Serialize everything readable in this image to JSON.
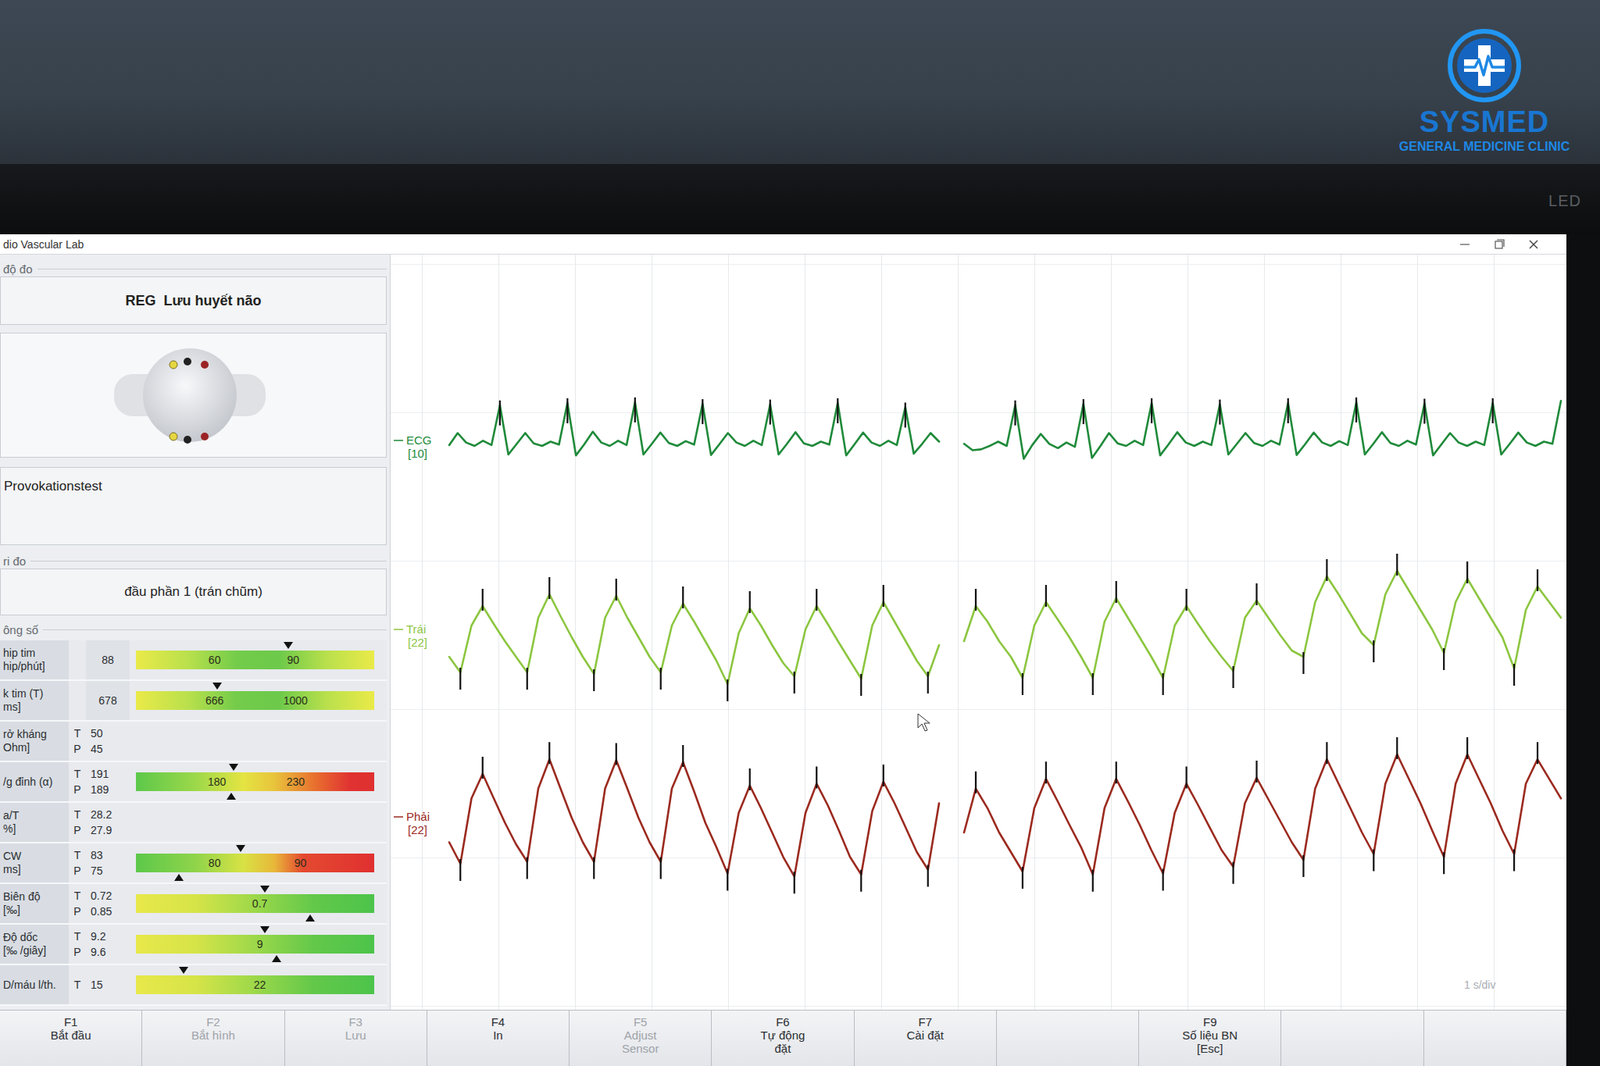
{
  "brand": {
    "name": "SYSMED",
    "tagline": "GENERAL MEDICINE CLINIC"
  },
  "monitor": {
    "badge": "LED"
  },
  "window": {
    "title": "dio Vascular Lab"
  },
  "mode": {
    "label": "độ đo",
    "value": "REG  Lưu huyết não"
  },
  "test": {
    "value": "Provokationstest"
  },
  "position": {
    "label": "ri đo",
    "value": "đầu phần 1 (trán chũm)"
  },
  "params": {
    "label": "ông số",
    "rows": [
      {
        "lines": [
          "hip tim",
          "hip/phút]"
        ],
        "values": [
          {
            "tag": "",
            "value": "88"
          }
        ],
        "bar": {
          "kind": "mid-good",
          "ticks": [
            {
              "label": "60",
              "level": 0.33
            },
            {
              "label": "90",
              "level": 0.66
            }
          ],
          "markers": [
            {
              "side": "top",
              "level": 0.64
            }
          ]
        }
      },
      {
        "lines": [
          "k tim (T)",
          "ms]"
        ],
        "values": [
          {
            "tag": "",
            "value": "678"
          }
        ],
        "bar": {
          "kind": "mid-good",
          "ticks": [
            {
              "label": "666",
              "level": 0.33
            },
            {
              "label": "1000",
              "level": 0.67
            }
          ],
          "markers": [
            {
              "side": "top",
              "level": 0.34
            }
          ]
        }
      },
      {
        "lines": [
          "rở kháng",
          "Ohm]"
        ],
        "values": [
          {
            "tag": "T",
            "value": "50"
          },
          {
            "tag": "P",
            "value": "45"
          }
        ],
        "bar": null
      },
      {
        "lines": [
          "/g đỉnh (α)"
        ],
        "values": [
          {
            "tag": "T",
            "value": "191"
          },
          {
            "tag": "P",
            "value": "189"
          }
        ],
        "bar": {
          "kind": "low-good",
          "ticks": [
            {
              "label": "180",
              "level": 0.34
            },
            {
              "label": "230",
              "level": 0.67
            }
          ],
          "markers": [
            {
              "side": "top",
              "level": 0.41
            },
            {
              "side": "bottom",
              "level": 0.4
            }
          ]
        }
      },
      {
        "lines": [
          "a/T",
          "%]"
        ],
        "values": [
          {
            "tag": "T",
            "value": "28.2"
          },
          {
            "tag": "P",
            "value": "27.9"
          }
        ],
        "bar": null
      },
      {
        "lines": [
          "CW",
          "ms]"
        ],
        "values": [
          {
            "tag": "T",
            "value": "83"
          },
          {
            "tag": "P",
            "value": "75"
          }
        ],
        "bar": {
          "kind": "low-good-steep",
          "ticks": [
            {
              "label": "80",
              "level": 0.33
            },
            {
              "label": "90",
              "level": 0.69
            }
          ],
          "markers": [
            {
              "side": "top",
              "level": 0.44
            },
            {
              "side": "bottom",
              "level": 0.18
            }
          ]
        }
      },
      {
        "lines": [
          "Biên độ",
          "[‰]"
        ],
        "values": [
          {
            "tag": "T",
            "value": "0.72"
          },
          {
            "tag": "P",
            "value": "0.85"
          }
        ],
        "bar": {
          "kind": "high-good",
          "ticks": [
            {
              "label": "0.7",
              "level": 0.52
            }
          ],
          "markers": [
            {
              "side": "top",
              "level": 0.54
            },
            {
              "side": "bottom",
              "level": 0.73
            }
          ]
        }
      },
      {
        "lines": [
          "Độ dốc",
          "[‰ /giây]"
        ],
        "values": [
          {
            "tag": "T",
            "value": "9.2"
          },
          {
            "tag": "P",
            "value": "9.6"
          }
        ],
        "bar": {
          "kind": "high-good",
          "ticks": [
            {
              "label": "9",
              "level": 0.52
            }
          ],
          "markers": [
            {
              "side": "top",
              "level": 0.54
            },
            {
              "side": "bottom",
              "level": 0.59
            }
          ]
        }
      },
      {
        "lines": [
          "D/máu l/th."
        ],
        "values": [
          {
            "tag": "T",
            "value": "15"
          }
        ],
        "bar": {
          "kind": "high-good",
          "ticks": [
            {
              "label": "22",
              "level": 0.52
            }
          ],
          "markers": [
            {
              "side": "top",
              "level": 0.2
            }
          ]
        }
      }
    ]
  },
  "chart": {
    "scale_note": "1 s/div",
    "traces": [
      {
        "name": "ECG",
        "scale": "[10]",
        "kind": "ecg",
        "color": "#1f8a3a",
        "segments": [
          [
            0.02,
            0.3,
            0.08,
            0,
            0.12,
            0.02,
            0.95,
            -0.2,
            0.05,
            0.3,
            0.06,
            0,
            0.1,
            0.03,
            1.0,
            -0.22,
            0.04,
            0.33,
            0.08,
            0,
            0.12,
            0.02,
            1.02,
            -0.2,
            0.05,
            0.31,
            0.07,
            0,
            0.11,
            0.03,
            0.98,
            -0.21,
            0.04,
            0.3,
            0.08,
            0,
            0.12,
            0.02,
            0.97,
            -0.2,
            0.05,
            0.32,
            0.06,
            0,
            0.1,
            0.03,
            1.0,
            -0.22,
            0.04,
            0.31,
            0.08,
            0,
            0.12,
            0.02,
            0.9,
            -0.18,
            0.05,
            0.3,
            0.1
          ],
          [
            0.05,
            -0.1,
            -0.08,
            0,
            0.1,
            0.0,
            0.95,
            -0.3,
            0.02,
            0.28,
            0.05,
            -0.05,
            0.08,
            -0.02,
            0.98,
            -0.28,
            0.0,
            0.3,
            0.06,
            0,
            0.12,
            0.02,
            1.0,
            -0.22,
            0.04,
            0.32,
            0.08,
            0,
            0.1,
            0.02,
            0.97,
            -0.2,
            0.05,
            0.3,
            0.07,
            0,
            0.12,
            0.03,
            1.0,
            -0.21,
            0.04,
            0.31,
            0.08,
            0,
            0.11,
            0.02,
            1.02,
            -0.2,
            0.05,
            0.32,
            0.07,
            0,
            0.12,
            0.03,
            0.99,
            -0.22,
            0.04,
            0.3,
            0.08,
            0,
            0.1,
            0.02,
            1.0,
            -0.2,
            0.05,
            0.31,
            0.08,
            0,
            0.1,
            0.05,
            1.05
          ]
        ]
      },
      {
        "name": "Trái",
        "scale": "[22]",
        "kind": "pulse",
        "color": "#8cc63f",
        "segments": [
          [
            0.3,
            0.1,
            0.7,
            0.95,
            0.72,
            0.5,
            0.3,
            0.1,
            0.8,
            1.1,
            0.82,
            0.55,
            0.3,
            0.08,
            0.8,
            1.08,
            0.8,
            0.55,
            0.3,
            0.1,
            0.7,
            0.98,
            0.75,
            0.5,
            0.25,
            -0.05,
            0.6,
            0.92,
            0.7,
            0.45,
            0.22,
            0.05,
            0.65,
            0.95,
            0.72,
            0.48,
            0.25,
            0.02,
            0.7,
            1.0,
            0.75,
            0.5,
            0.25,
            0.05,
            0.45
          ],
          [
            0.5,
            0.95,
            0.75,
            0.5,
            0.3,
            0.03,
            0.7,
            1.0,
            0.78,
            0.55,
            0.3,
            0.03,
            0.75,
            1.05,
            0.8,
            0.55,
            0.3,
            0.03,
            0.7,
            0.95,
            0.72,
            0.5,
            0.3,
            0.12,
            0.8,
            1.02,
            0.8,
            0.58,
            0.38,
            0.3,
            1.0,
            1.33,
            1.1,
            0.85,
            0.6,
            0.45,
            1.1,
            1.4,
            1.15,
            0.9,
            0.65,
            0.35,
            1.0,
            1.3,
            1.05,
            0.8,
            0.55,
            0.15,
            0.9,
            1.2,
            1.0,
            0.8
          ]
        ]
      },
      {
        "name": "Phải",
        "scale": "[22]",
        "kind": "pulse",
        "color": "#9b2a1f",
        "segments": [
          [
            0.3,
            0.08,
            0.75,
            1.0,
            0.75,
            0.5,
            0.28,
            0.1,
            0.85,
            1.15,
            0.85,
            0.55,
            0.3,
            0.1,
            0.85,
            1.14,
            0.85,
            0.55,
            0.3,
            0.1,
            0.85,
            1.12,
            0.82,
            0.5,
            0.25,
            -0.02,
            0.6,
            0.88,
            0.65,
            0.4,
            0.15,
            -0.05,
            0.6,
            0.9,
            0.68,
            0.42,
            0.15,
            -0.03,
            0.62,
            0.92,
            0.7,
            0.45,
            0.2,
            0.02,
            0.7
          ],
          [
            0.4,
            0.85,
            0.65,
            0.4,
            0.2,
            0.0,
            0.65,
            0.95,
            0.72,
            0.48,
            0.25,
            -0.03,
            0.65,
            0.95,
            0.72,
            0.48,
            0.22,
            -0.02,
            0.6,
            0.9,
            0.68,
            0.45,
            0.22,
            0.05,
            0.7,
            0.96,
            0.74,
            0.52,
            0.3,
            0.12,
            0.85,
            1.15,
            0.9,
            0.65,
            0.4,
            0.18,
            0.9,
            1.2,
            0.95,
            0.7,
            0.42,
            0.15,
            0.9,
            1.2,
            0.95,
            0.7,
            0.42,
            0.18,
            0.9,
            1.15,
            0.95,
            0.75
          ]
        ]
      }
    ]
  },
  "function_keys": [
    {
      "key": "F1",
      "lines": [
        "Bắt đầu"
      ],
      "disabled": false
    },
    {
      "key": "F2",
      "lines": [
        "Bắt hình"
      ],
      "disabled": true
    },
    {
      "key": "F3",
      "lines": [
        "Lưu"
      ],
      "disabled": true
    },
    {
      "key": "F4",
      "lines": [
        "In"
      ],
      "disabled": false
    },
    {
      "key": "F5",
      "lines": [
        "Adjust",
        "Sensor"
      ],
      "disabled": true
    },
    {
      "key": "F6",
      "lines": [
        "Tự động",
        "đặt"
      ],
      "disabled": false
    },
    {
      "key": "F7",
      "lines": [
        "Cài đặt"
      ],
      "disabled": false
    },
    {
      "key": "",
      "lines": [],
      "disabled": false
    },
    {
      "key": "F9",
      "lines": [
        "Số liệu BN",
        "[Esc]"
      ],
      "disabled": false
    },
    {
      "key": "",
      "lines": [],
      "disabled": false
    },
    {
      "key": "",
      "lines": [],
      "disabled": false
    }
  ]
}
